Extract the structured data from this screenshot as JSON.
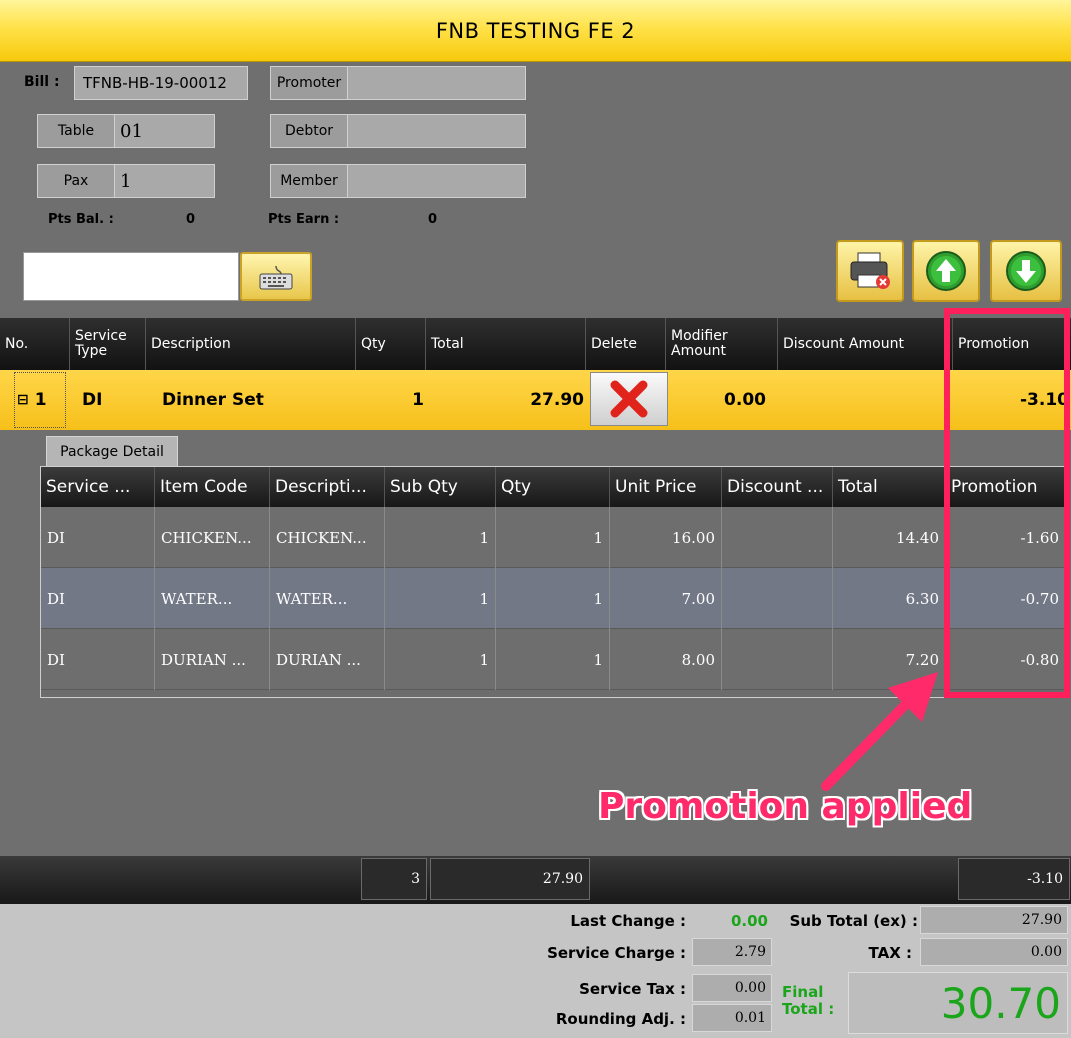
{
  "window": {
    "title": "FNB TESTING FE 2"
  },
  "header": {
    "bill_label": "Bill :",
    "bill_value": "TFNB-HB-19-00012",
    "table_label": "Table",
    "table_value": "01",
    "pax_label": "Pax",
    "pax_value": "1",
    "promoter_label": "Promoter",
    "promoter_value": "",
    "debtor_label": "Debtor",
    "debtor_value": "",
    "member_label": "Member",
    "member_value": "",
    "pts_bal_label": "Pts Bal. :",
    "pts_bal_value": "0",
    "pts_earn_label": "Pts Earn :",
    "pts_earn_value": "0"
  },
  "search": {
    "value": "",
    "keyboard_icon": "keyboard-icon"
  },
  "toolbar": {
    "print_icon": "printer-cancel-icon",
    "up_icon": "arrow-up-icon",
    "down_icon": "arrow-down-icon"
  },
  "grid": {
    "columns": [
      "No.",
      "Service Type",
      "Description",
      "Qty",
      "Total",
      "Delete",
      "Modifier Amount",
      "Discount Amount",
      "Promotion"
    ],
    "row": {
      "expander": "⊟",
      "no": "1",
      "service_type": "DI",
      "description": "Dinner Set",
      "qty": "1",
      "total": "27.90",
      "modifier_amount": "0.00",
      "discount_amount": "",
      "promotion": "-3.10"
    }
  },
  "package": {
    "tab_label": "Package Detail",
    "columns": [
      "Service ...",
      "Item Code",
      "Descripti...",
      "Sub Qty",
      "Qty",
      "Unit Price",
      "Discount ...",
      "Total",
      "Promotion"
    ],
    "rows": [
      {
        "service": "DI",
        "item_code": "CHICKEN...",
        "description": "CHICKEN...",
        "sub_qty": "1",
        "qty": "1",
        "unit_price": "16.00",
        "discount": "",
        "total": "14.40",
        "promotion": "-1.60"
      },
      {
        "service": "DI",
        "item_code": "WATER...",
        "description": "WATER...",
        "sub_qty": "1",
        "qty": "1",
        "unit_price": "7.00",
        "discount": "",
        "total": "6.30",
        "promotion": "-0.70"
      },
      {
        "service": "DI",
        "item_code": "DURIAN ...",
        "description": "DURIAN ...",
        "sub_qty": "1",
        "qty": "1",
        "unit_price": "8.00",
        "discount": "",
        "total": "7.20",
        "promotion": "-0.80"
      }
    ]
  },
  "annotation": {
    "text": "Promotion applied",
    "color": "#ff1f5a"
  },
  "totals_bar": {
    "qty": "3",
    "total": "27.90",
    "promotion": "-3.10"
  },
  "footer": {
    "last_change_label": "Last Change :",
    "last_change_value": "0.00",
    "service_charge_label": "Service Charge :",
    "service_charge_value": "2.79",
    "service_tax_label": "Service Tax :",
    "service_tax_value": "0.00",
    "rounding_label": "Rounding Adj. :",
    "rounding_value": "0.01",
    "subtotal_label": "Sub Total (ex) :",
    "subtotal_value": "27.90",
    "tax_label": "TAX :",
    "tax_value": "0.00",
    "final_total_label_1": "Final",
    "final_total_label_2": "Total :",
    "final_total_value": "30.70"
  }
}
